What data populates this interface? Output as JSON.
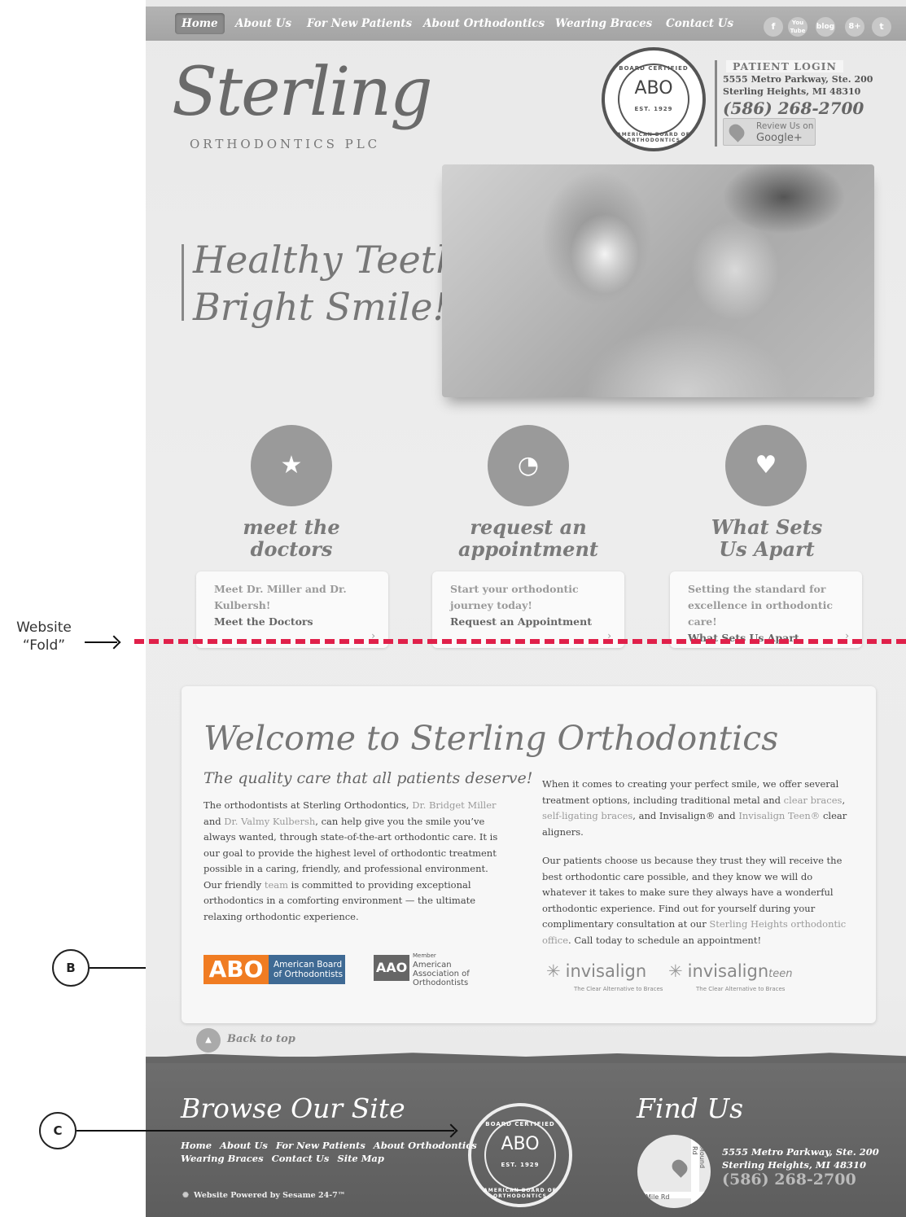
{
  "annotations": {
    "fold_label_line1": "Website",
    "fold_label_line2": "“Fold”",
    "marker_b": "B",
    "marker_c": "C"
  },
  "nav": {
    "items": [
      "Home",
      "About Us",
      "For New Patients",
      "About Orthodontics",
      "Wearing Braces",
      "Contact Us"
    ],
    "active": "Home",
    "social": [
      {
        "icon": "facebook-icon",
        "glyph": "f"
      },
      {
        "icon": "youtube-icon",
        "glyph": "You Tube"
      },
      {
        "icon": "blog-icon",
        "glyph": "blog"
      },
      {
        "icon": "google-plus-icon",
        "glyph": "8+"
      },
      {
        "icon": "twitter-icon",
        "glyph": "t"
      }
    ]
  },
  "header": {
    "logo_script": "Sterling",
    "logo_sub": "ORTHODONTICS PLC",
    "seal_top": "BOARD CERTIFIED",
    "seal_mark": "ABO",
    "seal_est": "EST. 1929",
    "seal_bottom": "AMERICAN BOARD OF ORTHODONTICS",
    "patient_login": "PATIENT LOGIN",
    "address_line1": "5555 Metro Parkway, Ste. 200",
    "address_line2": "Sterling Heights, MI 48310",
    "phone": "(586) 268-2700",
    "review_line1": "Review Us on",
    "review_line2": "Google+"
  },
  "hero": {
    "line1": "Healthy Teeth",
    "line2": "Bright Smile!"
  },
  "features": [
    {
      "icon": "star-icon",
      "glyph": "★",
      "title1": "meet the",
      "title2": "doctors",
      "desc1": "Meet Dr. Miller and Dr.",
      "desc2": "Kulbersh!",
      "link": "Meet the Doctors"
    },
    {
      "icon": "clock-icon",
      "glyph": "◔",
      "title1": "request an",
      "title2": "appointment",
      "desc1": "Start your orthodontic",
      "desc2": "journey today!",
      "link": "Request an Appointment"
    },
    {
      "icon": "heart-icon",
      "glyph": "♥",
      "title1": "What Sets",
      "title2": "Us Apart",
      "desc1": "Setting the standard for",
      "desc2": "excellence in orthodontic",
      "desc3": "care!",
      "link": "What Sets Us Apart"
    }
  ],
  "welcome": {
    "title": "Welcome to Sterling Orthodontics",
    "subtitle": "The quality care that all patients deserve!",
    "left_p1_a": "The orthodontists at Sterling Orthodontics, ",
    "left_link1": "Dr. Bridget Miller",
    "left_p1_b": " and ",
    "left_link2": "Dr. Valmy Kulbersh",
    "left_p1_c": ", can help give you the smile you’ve always wanted, through state-of-the-art orthodontic care. It is our goal to provide the highest level of orthodontic treatment possible in a caring, friendly, and professional environment. Our friendly ",
    "left_link3": "team",
    "left_p1_d": " is committed to providing exceptional orthodontics in a comforting environment — the ultimate relaxing orthodontic experience.",
    "right_p1_a": "When it comes to creating your perfect smile, we offer several treatment options, including traditional metal and ",
    "right_link1": "clear braces",
    "right_p1_b": ", ",
    "right_link2": "self-ligating braces",
    "right_p1_c": ", and ",
    "right_link3": "Invisalign®",
    "right_p1_d": " and ",
    "right_link4": "Invisalign Teen®",
    "right_p1_e": " clear aligners.",
    "right_p2_a": "Our patients choose us because they trust they will receive the best orthodontic care possible, and they know we will do whatever it takes to make sure they always have a wonderful orthodontic experience. Find out for yourself during your complimentary consultation at our ",
    "right_link5": "Sterling Heights orthodontic office",
    "right_p2_b": ". Call today to schedule an appointment!",
    "abo_logo_mark": "ABO",
    "abo_logo_text1": "American Board",
    "abo_logo_text2": "of Orthodontists",
    "aao_logo_mark": "AAO",
    "aao_member": "Member",
    "aao_text1": "American",
    "aao_text2": "Association of",
    "aao_text3": "Orthodontists",
    "invisalign": "invisalign",
    "invisalign_teen": "invisalign",
    "invisalign_teen_suffix": "teen",
    "invisalign_tag": "The Clear Alternative to Braces",
    "invisalign_teen_tag": "The Clear Alternative to Braces",
    "back_to_top": "Back to top"
  },
  "footer": {
    "browse_title": "Browse Our Site",
    "links_row1": [
      "Home",
      "About Us",
      "For New Patients",
      "About Orthodontics"
    ],
    "links_row2": [
      "Wearing Braces",
      "Contact Us",
      "Site Map"
    ],
    "powered": "Website Powered by Sesame 24-7™",
    "find_title": "Find Us",
    "map_road1": "Mile Rd",
    "map_road2": "Mound Rd",
    "map_pin": "A",
    "address_line1": "5555 Metro Parkway, Ste. 200",
    "address_line2": "Sterling Heights, MI 48310",
    "phone": "(586) 268-2700"
  },
  "colors": {
    "fold_line": "#e0204a",
    "abo_orange": "#f07c22",
    "abo_blue": "#3f6a94"
  }
}
